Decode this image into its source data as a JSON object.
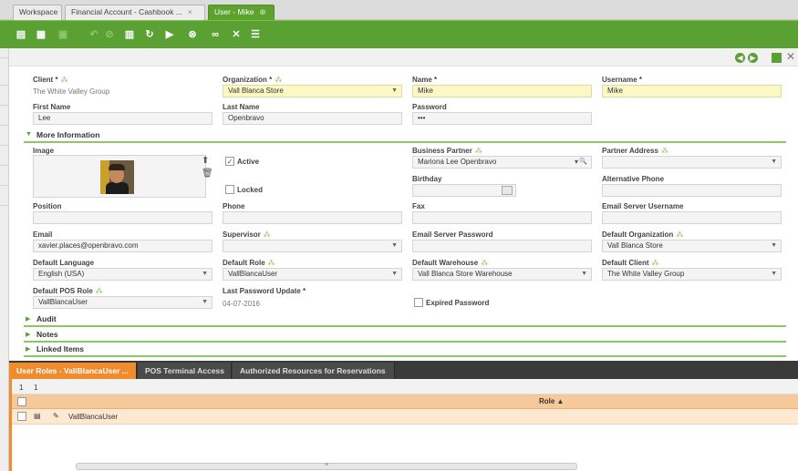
{
  "window_tabs": [
    {
      "label": "Workspace",
      "close": ""
    },
    {
      "label": "Financial Account - Cashbook ...",
      "close": "×"
    },
    {
      "label": "User - Mike",
      "close": "⊗"
    }
  ],
  "toolbar": {
    "icons": [
      "new-document-icon",
      "new-row-icon",
      "save-icon",
      "undo-icon",
      "delete-icon",
      "refresh-icon",
      "export-icon",
      "attach-icon",
      "link-icon",
      "tools-icon",
      "list-icon"
    ]
  },
  "colors": {
    "accent": "#5aa033",
    "required_bg": "#fbf8c6",
    "subtab_active": "#f08c2e",
    "grid_header": "#f6c99b"
  },
  "form": {
    "client": {
      "label": "Client *",
      "value": "The White Valley Group"
    },
    "organization": {
      "label": "Organization *",
      "value": "Vall Blanca Store"
    },
    "name": {
      "label": "Name *",
      "value": "Mike"
    },
    "username": {
      "label": "Username *",
      "value": "Mike"
    },
    "first_name": {
      "label": "First Name",
      "value": "Lee"
    },
    "last_name": {
      "label": "Last Name",
      "value": "Openbravo"
    },
    "password": {
      "label": "Password",
      "value": "•••"
    },
    "more_info": "More Information",
    "image": {
      "label": "Image"
    },
    "active": {
      "label": "Active",
      "checked": true
    },
    "locked": {
      "label": "Locked",
      "checked": false
    },
    "business_partner": {
      "label": "Business Partner",
      "value": "Mariona Lee Openbravo"
    },
    "partner_address": {
      "label": "Partner Address",
      "value": ""
    },
    "birthday": {
      "label": "Birthday",
      "value": ""
    },
    "alternative_phone": {
      "label": "Alternative Phone",
      "value": ""
    },
    "position": {
      "label": "Position",
      "value": ""
    },
    "phone": {
      "label": "Phone",
      "value": ""
    },
    "fax": {
      "label": "Fax",
      "value": ""
    },
    "email_server_username": {
      "label": "Email Server Username",
      "value": ""
    },
    "email": {
      "label": "Email",
      "value": "xavier.places@openbravo.com"
    },
    "supervisor": {
      "label": "Supervisor",
      "value": ""
    },
    "email_server_password": {
      "label": "Email Server Password",
      "value": ""
    },
    "default_organization": {
      "label": "Default Organization",
      "value": "Vall Blanca Store"
    },
    "default_language": {
      "label": "Default Language",
      "value": "English (USA)"
    },
    "default_role": {
      "label": "Default Role",
      "value": "VallBlancaUser"
    },
    "default_warehouse": {
      "label": "Default Warehouse",
      "value": "Vall Blanca Store Warehouse"
    },
    "default_client": {
      "label": "Default Client",
      "value": "The White Valley Group"
    },
    "default_pos_role": {
      "label": "Default POS Role",
      "value": "VallBlancaUser"
    },
    "last_password_update": {
      "label": "Last Password Update *",
      "value": "04-07-2016"
    },
    "expired_password": {
      "label": "Expired Password",
      "checked": false
    }
  },
  "sections": [
    "Audit",
    "Notes",
    "Linked Items"
  ],
  "subtabs": [
    "User Roles - VallBlancaUser ...",
    "POS Terminal Access",
    "Authorized Resources for Reservations"
  ],
  "grid": {
    "nav": [
      "1",
      "1"
    ],
    "columns": [
      {
        "label": "Role ▲"
      }
    ],
    "rows": [
      {
        "role": "VallBlancaUser"
      }
    ],
    "scroll_mark": "≡"
  }
}
